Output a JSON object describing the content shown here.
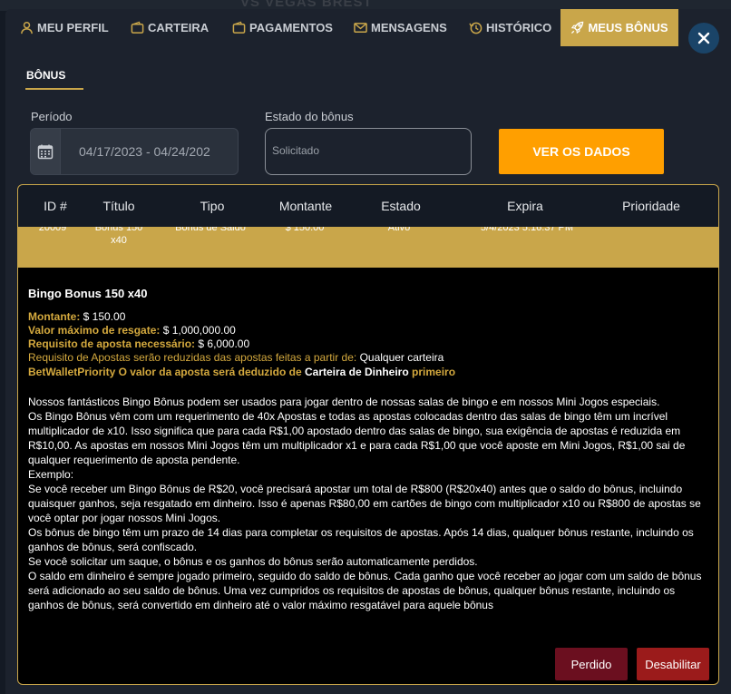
{
  "background": {
    "logo_text": "VS  VEGAS BREST"
  },
  "nav": {
    "tabs": [
      {
        "label": "MEU PERFIL",
        "icon": "user-icon"
      },
      {
        "label": "CARTEIRA",
        "icon": "wallet-icon"
      },
      {
        "label": "PAGAMENTOS",
        "icon": "wallet-icon"
      },
      {
        "label": "MENSAGENS",
        "icon": "envelope-icon"
      },
      {
        "label": "HISTÓRICO",
        "icon": "history-icon"
      },
      {
        "label": "MEUS BÔNUS",
        "icon": "rocket-icon",
        "active": true
      }
    ],
    "close_icon": "close-icon"
  },
  "subtab": {
    "label": "BÔNUS"
  },
  "filters": {
    "period_label": "Período",
    "period_value": "04/17/2023 - 04/24/202",
    "status_label": "Estado do bônus",
    "status_value": "Solicitado",
    "submit_label": "VER OS DADOS"
  },
  "table": {
    "headers": [
      "ID #",
      "Título",
      "Tipo",
      "Montante",
      "Estado",
      "Expira",
      "Prioridade"
    ],
    "row": {
      "id": "20009",
      "title_line1": "Bônus 150",
      "title_line2": "x40",
      "type": "Bônus de Saldo",
      "amount": "$ 150.00",
      "state": "Ativo",
      "expires": "5/4/2023 5:16:37 PM"
    }
  },
  "details": {
    "title": "Bingo Bonus 150 x40",
    "amount_label": "Montante:",
    "amount_value": "$ 150.00",
    "max_redeem_label": "Valor máximo de resgate:",
    "max_redeem_value": "$ 1,000,000.00",
    "wager_label": "Requisito de aposta necessário:",
    "wager_value": "$ 6,000.00",
    "reduction_label": "Requisito de Apostas serão reduzidas das apostas feitas a partir de:",
    "reduction_value": "Qualquer carteira",
    "priority_label": "BetWalletPriority O valor da aposta será deduzido de",
    "priority_value": "Carteira de Dinheiro",
    "priority_suffix": "primeiro",
    "description": [
      "Nossos fantásticos Bingo Bônus podem ser usados para jogar dentro de nossas salas de bingo e em nossos Mini Jogos especiais.",
      "Os Bingo Bônus vêm com um requerimento de 40x Apostas e todas as apostas colocadas dentro das salas de bingo têm um incrível multiplicador de x10. Isso significa que para cada R$1,00 apostado dentro das salas de bingo, sua exigência de apostas é reduzida em R$10,00.  As apostas em nossos Mini Jogos têm um multiplicador x1 e para cada R$1,00 que você aposte em Mini Jogos, R$1,00 sai de qualquer requerimento de aposta pendente.",
      "Exemplo:",
      "Se você receber um Bingo Bônus de R$20, você precisará apostar um total de R$800 (R$20x40) antes que o saldo do bônus, incluindo quaisquer ganhos, seja resgatado em dinheiro. Isso é apenas R$80,00 em cartões de bingo com multiplicador x10 ou R$800 de apostas se você optar por jogar nossos Mini Jogos.",
      "Os bônus de bingo têm um prazo de 14 dias para completar os requisitos de apostas. Após 14 dias, qualquer bônus restante, incluindo os ganhos de bônus, será confiscado.",
      "Se você solicitar um saque, o bônus e os ganhos do bônus serão automaticamente perdidos.",
      "O saldo em dinheiro é sempre jogado primeiro, seguido do saldo de bônus. Cada ganho que você receber ao jogar com um saldo de bônus será adicionado ao seu saldo de bônus. Uma vez cumpridos os requisitos de apostas de bônus, qualquer bônus restante, incluindo os ganhos de bônus, será convertido em dinheiro até o valor máximo resgatável para aquele bônus"
    ],
    "lost_button": "Perdido",
    "disable_button": "Desabilitar"
  }
}
